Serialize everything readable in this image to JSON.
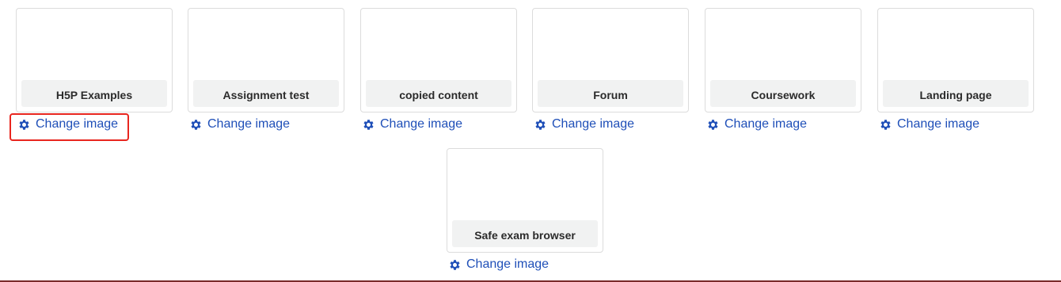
{
  "colors": {
    "link": "#1f4fb8",
    "highlight": "#e8261f",
    "label_bg": "#f1f2f2",
    "card_border": "#dcdcdc"
  },
  "tiles": [
    {
      "title": "H5P Examples",
      "action_label": "Change image",
      "action_icon": "gear-icon"
    },
    {
      "title": "Assignment test",
      "action_label": "Change image",
      "action_icon": "gear-icon"
    },
    {
      "title": "copied content",
      "action_label": "Change image",
      "action_icon": "gear-icon"
    },
    {
      "title": "Forum",
      "action_label": "Change image",
      "action_icon": "gear-icon"
    },
    {
      "title": "Coursework",
      "action_label": "Change image",
      "action_icon": "gear-icon"
    },
    {
      "title": "Landing page",
      "action_label": "Change image",
      "action_icon": "gear-icon"
    },
    {
      "title": "Safe exam browser",
      "action_label": "Change image",
      "action_icon": "gear-icon"
    }
  ]
}
